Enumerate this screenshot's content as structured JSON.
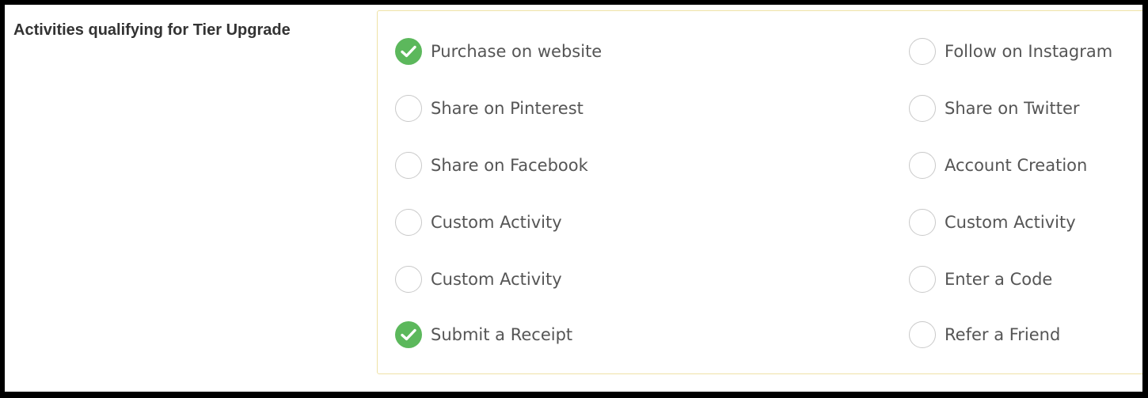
{
  "section": {
    "label": "Activities qualifying for Tier Upgrade"
  },
  "activities": {
    "left": [
      {
        "label": "Purchase on website",
        "checked": true
      },
      {
        "label": "Share on Pinterest",
        "checked": false
      },
      {
        "label": "Share on Facebook",
        "checked": false
      },
      {
        "label": "Custom Activity",
        "checked": false
      },
      {
        "label": "Custom Activity",
        "checked": false
      },
      {
        "label": "Submit a Receipt",
        "checked": true
      }
    ],
    "right": [
      {
        "label": "Follow on Instagram",
        "checked": false
      },
      {
        "label": "Share on Twitter",
        "checked": false
      },
      {
        "label": "Account Creation",
        "checked": false
      },
      {
        "label": "Custom Activity",
        "checked": false
      },
      {
        "label": "Enter a Code",
        "checked": false
      },
      {
        "label": "Refer a Friend",
        "checked": false
      }
    ]
  },
  "colors": {
    "checked_fill": "#5cb85c",
    "unchecked_border": "#c9c9c9",
    "panel_border": "#efe2a6"
  },
  "icons": {
    "checked": "checkmark-icon",
    "unchecked": "empty-circle-icon"
  }
}
